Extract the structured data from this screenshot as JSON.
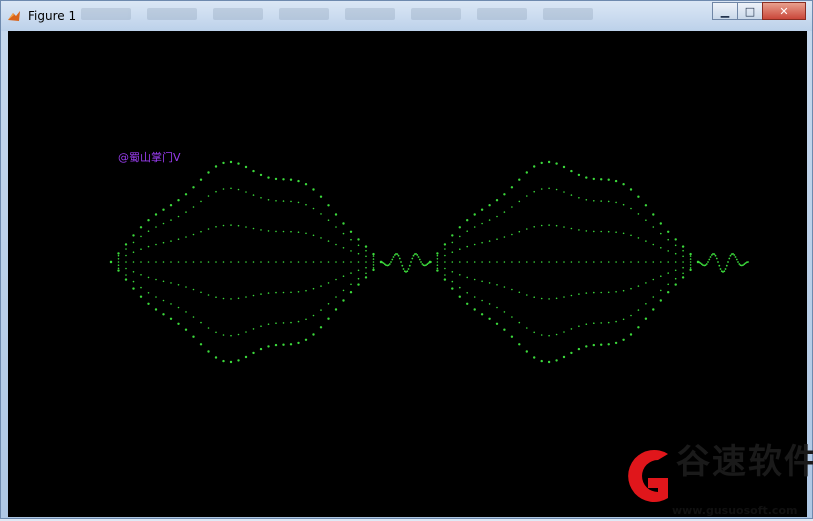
{
  "window": {
    "title": "Figure 1",
    "minimize_glyph": "▁",
    "maximize_glyph": "□",
    "close_glyph": "✕"
  },
  "figure": {
    "watermark": "@蜀山掌门V",
    "plot_color": "#3bd93b",
    "background": "#000000"
  },
  "branding": {
    "name": "谷速软件",
    "url": "www.gusuosoft.com",
    "accent_color": "#e0161b"
  }
}
